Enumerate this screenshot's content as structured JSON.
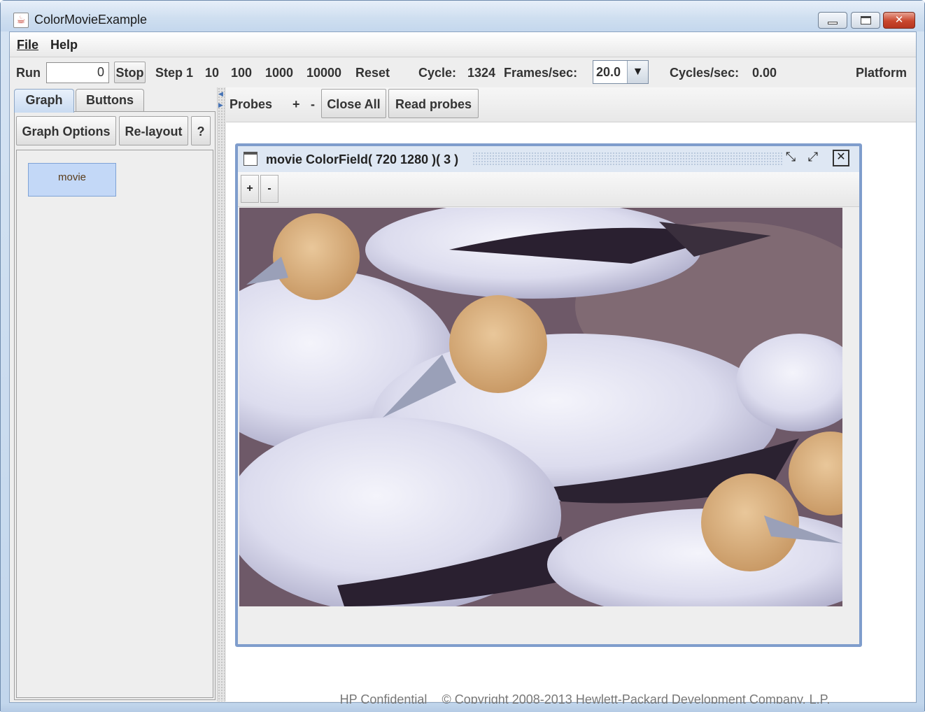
{
  "window": {
    "title": "ColorMovieExample",
    "app_icon": "java-cup-icon",
    "controls": [
      "minimize-icon",
      "maximize-icon",
      "close-icon"
    ]
  },
  "menu": {
    "items": [
      "File",
      "Help"
    ]
  },
  "toolbar": {
    "run_label": "Run",
    "run_value": "0",
    "stop_label": "Stop",
    "step_labels": [
      "Step 1",
      "10",
      "100",
      "1000",
      "10000"
    ],
    "reset_label": "Reset",
    "cycle_label": "Cycle:",
    "cycle_value": "1324",
    "fps_label": "Frames/sec:",
    "fps_value": "20.0",
    "cps_label": "Cycles/sec:",
    "cps_value": "0.00",
    "platform_label": "Platform"
  },
  "left_panel": {
    "tabs": [
      "Graph",
      "Buttons"
    ],
    "active_tab": "Graph",
    "buttons": [
      "Graph Options",
      "Re-layout",
      "?"
    ],
    "graph_nodes": [
      "movie"
    ]
  },
  "probes_bar": {
    "label": "Probes",
    "plus": "+",
    "minus": "-",
    "close_all": "Close All",
    "read_probes": "Read probes"
  },
  "probe_window": {
    "title": "movie ColorField( 720 1280 )( 3 )",
    "zoom_in": "+",
    "zoom_out": "-",
    "image": "movie-frame-gannets"
  },
  "footer": {
    "confidential": "HP Confidential",
    "copyright": "© Copyright 2008-2013 Hewlett-Packard Development Company, L.P."
  },
  "colors": {
    "accent": "#7f9dcc",
    "graph_node_fill": "#c3d8f7",
    "title_gradient": "#cfdff0"
  }
}
